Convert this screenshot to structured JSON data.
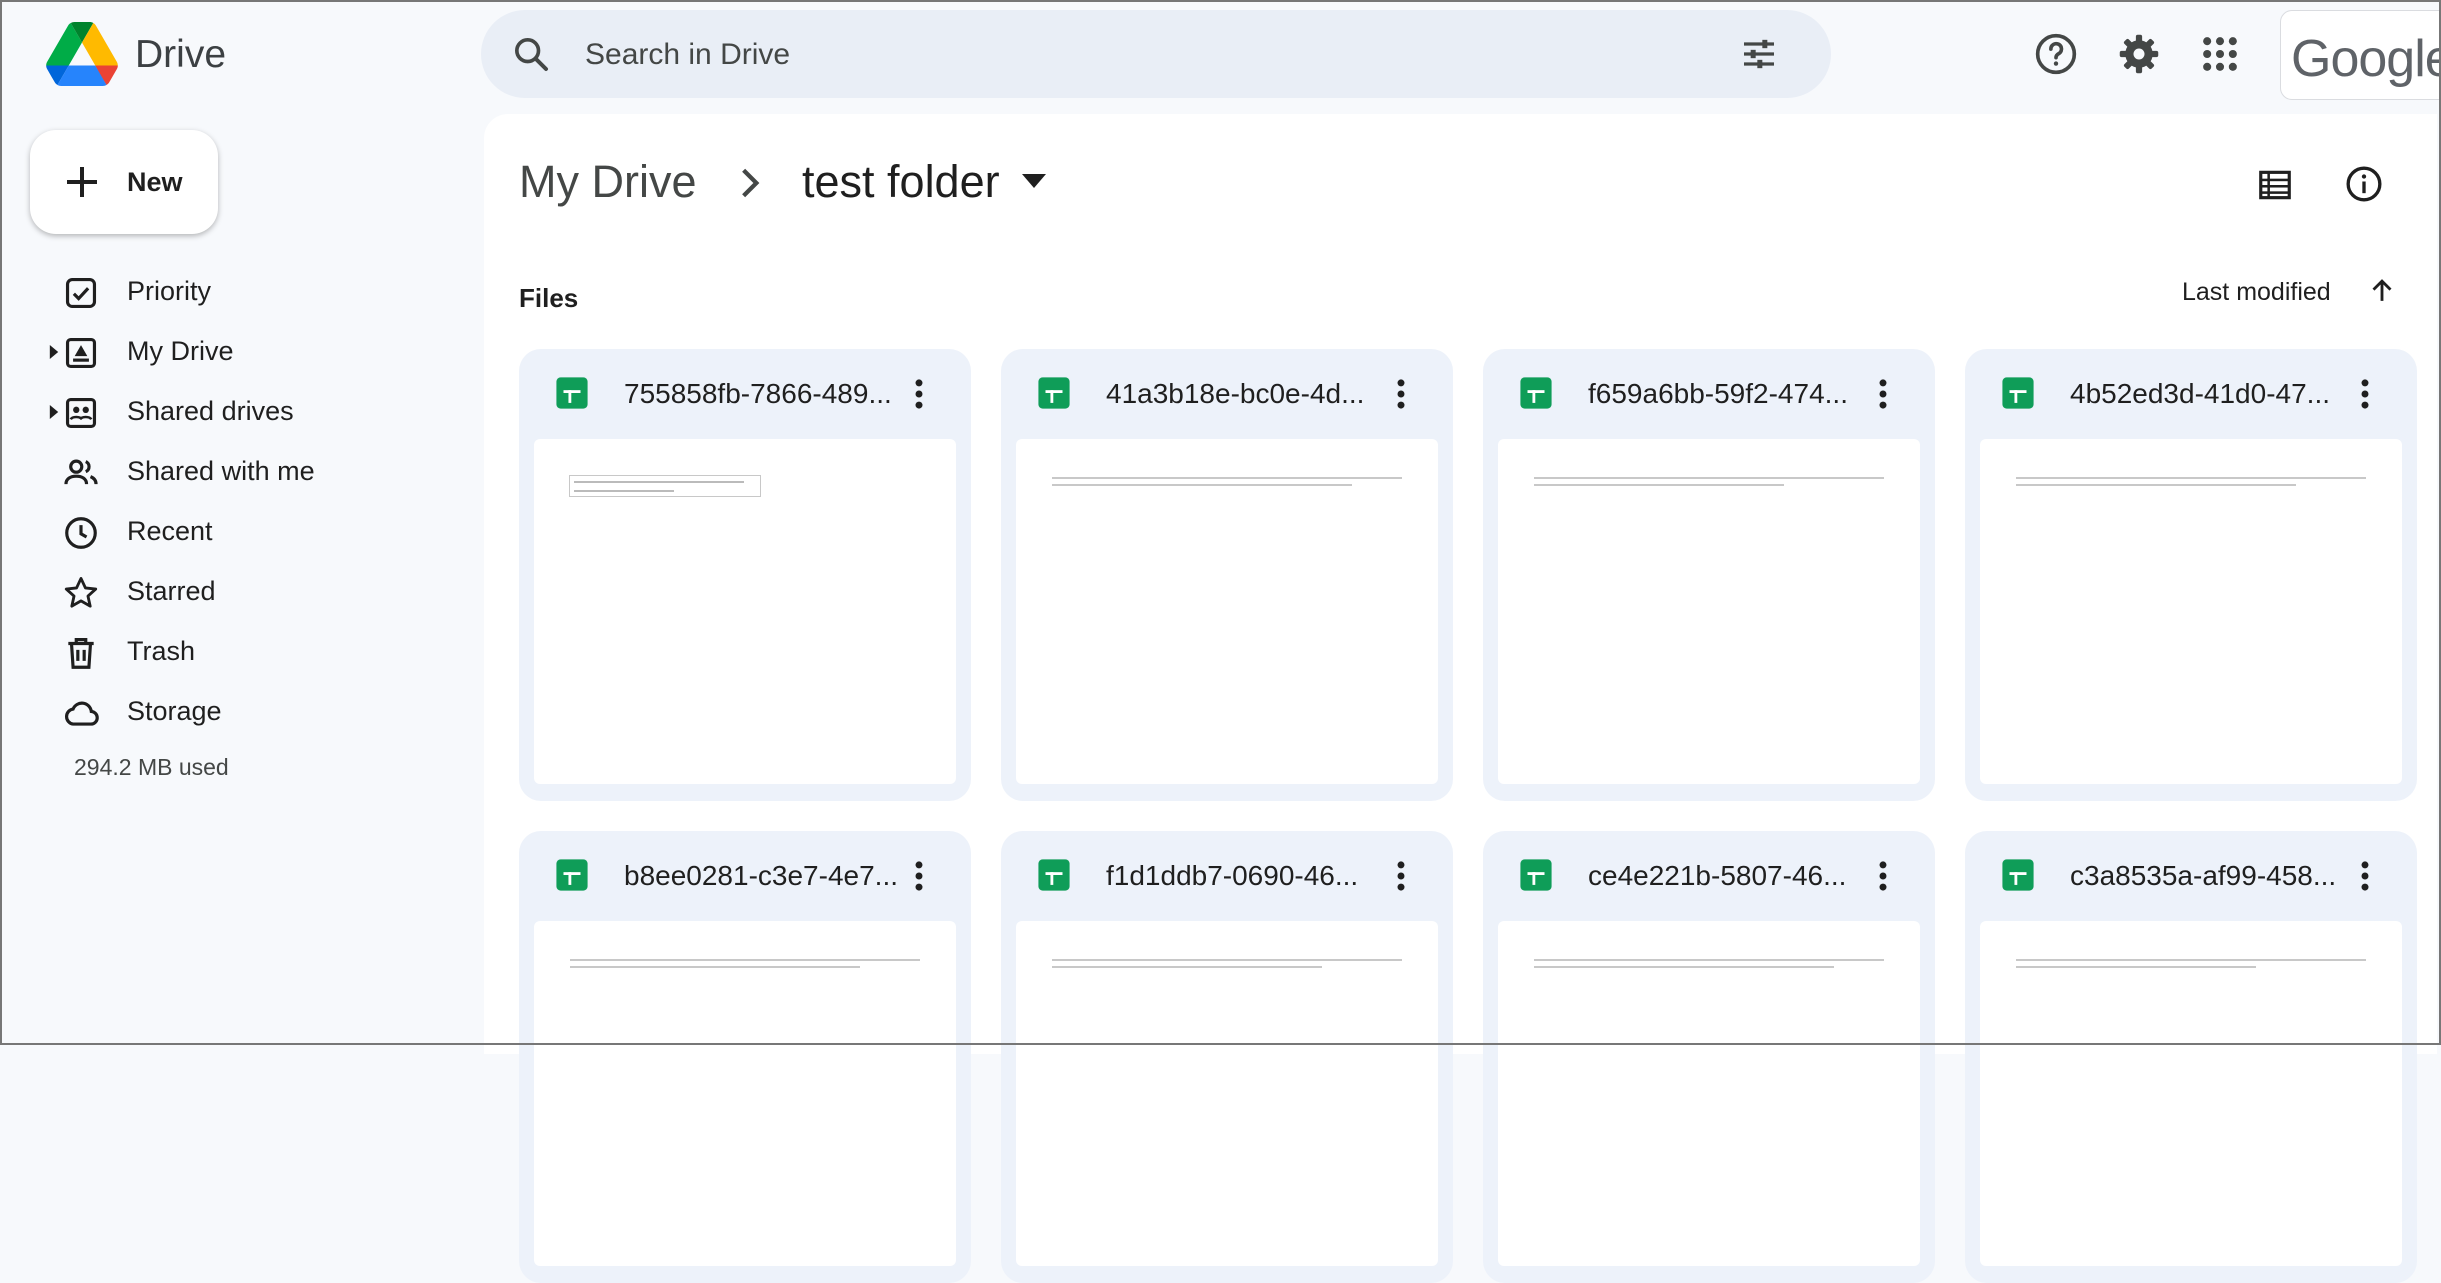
{
  "app": {
    "name": "Drive"
  },
  "search": {
    "placeholder": "Search in Drive"
  },
  "header": {
    "account_logo": "Google"
  },
  "sidebar": {
    "new_label": "New",
    "items": [
      {
        "label": "Priority",
        "icon": "priority-icon"
      },
      {
        "label": "My Drive",
        "icon": "my-drive-icon"
      },
      {
        "label": "Shared drives",
        "icon": "shared-drives-icon"
      },
      {
        "label": "Shared with me",
        "icon": "shared-with-me-icon"
      },
      {
        "label": "Recent",
        "icon": "clock-icon"
      },
      {
        "label": "Starred",
        "icon": "star-icon"
      },
      {
        "label": "Trash",
        "icon": "trash-icon"
      },
      {
        "label": "Storage",
        "icon": "cloud-icon"
      }
    ],
    "storage_used": "294.2 MB used"
  },
  "breadcrumb": {
    "parent": "My Drive",
    "current": "test folder"
  },
  "section": {
    "files_label": "Files",
    "sort_label": "Last modified"
  },
  "files": [
    {
      "name": "755858fb-7866-489..."
    },
    {
      "name": "41a3b18e-bc0e-4d..."
    },
    {
      "name": "f659a6bb-59f2-474..."
    },
    {
      "name": "4b52ed3d-41d0-47..."
    },
    {
      "name": "b8ee0281-c3e7-4e7..."
    },
    {
      "name": "f1d1ddb7-0690-46..."
    },
    {
      "name": "ce4e221b-5807-46..."
    },
    {
      "name": "c3a8535a-af99-458..."
    }
  ],
  "colors": {
    "sheets_green": "#0f9d58",
    "background": "#f7f9fc",
    "search_bg": "#e9eef6",
    "card_bg": "#edf2fa"
  }
}
